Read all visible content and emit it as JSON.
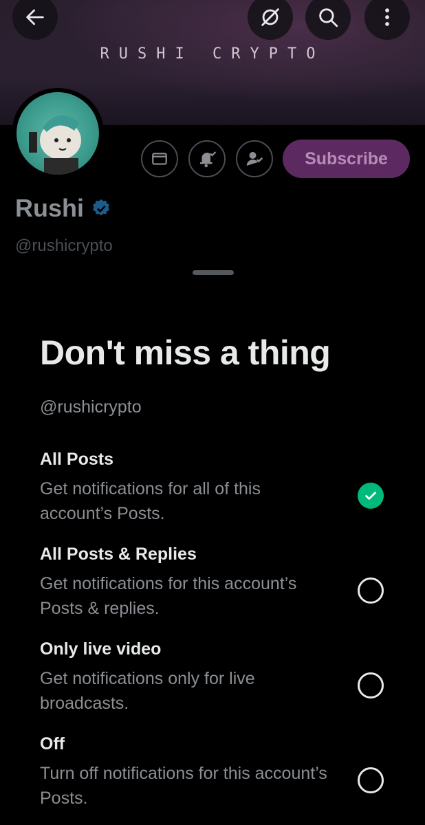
{
  "banner": {
    "title": "RUSHI CRYPTO"
  },
  "profile": {
    "name": "Rushi",
    "handle": "@rushicrypto",
    "subscribe_label": "Subscribe"
  },
  "sheet": {
    "title": "Don't miss a thing",
    "handle": "@rushicrypto",
    "options": [
      {
        "title": "All Posts",
        "desc": "Get notifications for all of this account’s Posts.",
        "selected": true
      },
      {
        "title": "All Posts & Replies",
        "desc": "Get notifications for this account’s Posts & replies.",
        "selected": false
      },
      {
        "title": "Only live video",
        "desc": "Get notifications only for live broadcasts.",
        "selected": false
      },
      {
        "title": "Off",
        "desc": "Turn off notifications for this account’s Posts.",
        "selected": false
      }
    ]
  },
  "colors": {
    "accent_green": "#00ba7c",
    "subscribe_bg": "#5c2a60",
    "verified_blue": "#1d9bf0"
  },
  "icons": [
    "back-arrow-icon",
    "grok-icon",
    "search-icon",
    "more-vertical-icon",
    "mail-icon",
    "bell-check-icon",
    "user-check-icon",
    "verified-badge-icon",
    "check-icon"
  ]
}
